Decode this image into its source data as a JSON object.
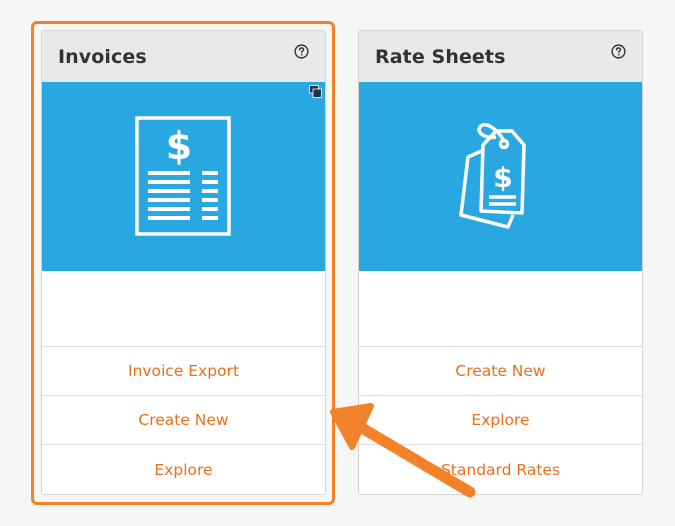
{
  "cards": [
    {
      "title": "Invoices",
      "links": [
        "Invoice Export",
        "Create New",
        "Explore"
      ]
    },
    {
      "title": "Rate Sheets",
      "links": [
        "Create New",
        "Explore",
        "Standard Rates"
      ]
    }
  ],
  "icons": {
    "help": "question-circle-icon",
    "invoices_banner": "invoice-document-icon",
    "rates_banner": "price-tag-icon",
    "corner": "window-icon"
  },
  "colors": {
    "banner": "#29a7e1",
    "link": "#e8701c",
    "highlight": "#f2822a",
    "header": "#e9e9e9"
  }
}
